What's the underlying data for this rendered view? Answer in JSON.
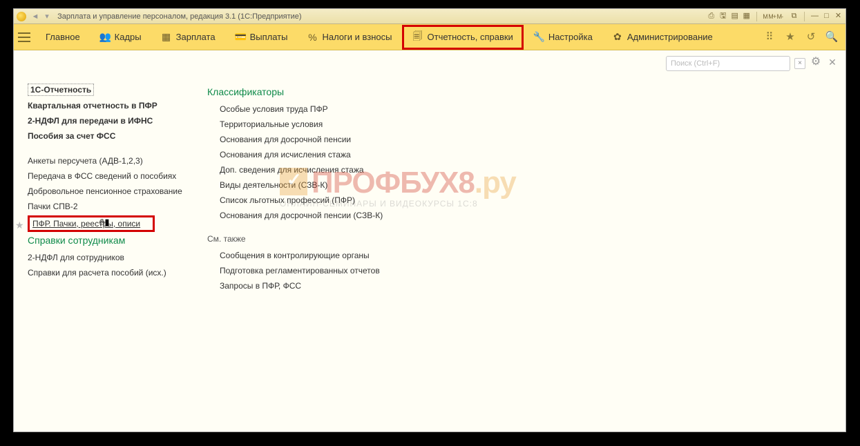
{
  "titlebar": {
    "title": "Зарплата и управление персоналом, редакция 3.1  (1С:Предприятие)",
    "mset": "M  M+  M-"
  },
  "nav": {
    "items": [
      {
        "icon": "≡",
        "name": "menu"
      },
      {
        "icon": "",
        "label": "Главное",
        "name": "main"
      },
      {
        "icon": "👥",
        "label": "Кадры",
        "name": "staff"
      },
      {
        "icon": "▦",
        "label": "Зарплата",
        "name": "salary"
      },
      {
        "icon": "💳",
        "label": "Выплаты",
        "name": "payments"
      },
      {
        "icon": "%",
        "label": "Налоги и взносы",
        "name": "taxes"
      },
      {
        "icon": "🗐",
        "label": "Отчетность, справки",
        "name": "reports",
        "active": true
      },
      {
        "icon": "🔧",
        "label": "Настройка",
        "name": "settings"
      },
      {
        "icon": "✿",
        "label": "Администрирование",
        "name": "admin"
      }
    ],
    "right": {
      "apps": "⠿",
      "star": "★",
      "history": "↺",
      "search": "🔍"
    }
  },
  "toolrow": {
    "search_placeholder": "Поиск (Ctrl+F)"
  },
  "left_col": {
    "top": [
      {
        "label": "1С-Отчетность",
        "dotted": true
      },
      {
        "label": "Квартальная отчетность в ПФР",
        "bold": true
      },
      {
        "label": "2-НДФЛ для передачи в ИФНС",
        "bold": true
      },
      {
        "label": "Пособия за счет ФСС",
        "bold": true
      }
    ],
    "mid": [
      {
        "label": "Анкеты персучета (АДВ-1,2,3)"
      },
      {
        "label": "Передача в ФСС сведений о пособиях"
      },
      {
        "label": "Добровольное пенсионное страхование"
      },
      {
        "label": "Пачки СПВ-2"
      }
    ],
    "highlighted": "ПФР. Пачки, реестры, описи",
    "section2": "Справки сотрудникам",
    "bottom": [
      {
        "label": "2-НДФЛ для сотрудников"
      },
      {
        "label": "Справки для расчета пособий (исх.)"
      }
    ]
  },
  "right_col": {
    "section": "Классификаторы",
    "items": [
      "Особые условия труда ПФР",
      "Территориальные условия",
      "Основания для досрочной пенсии",
      "Основания для исчисления стажа",
      "Доп. сведения для исчисления стажа",
      "Виды деятельности (СЗВ-К)",
      "Список льготных профессий (ПФР)",
      "Основания для досрочной пенсии (СЗВ-К)"
    ],
    "see_also_head": "См. также",
    "see_also": [
      "Сообщения в контролирующие органы",
      "Подготовка регламентированных отчетов",
      "Запросы в ПФР, ФСС"
    ]
  },
  "watermark": {
    "brand": "ПРОФБУХ8",
    "suffix": ".ру",
    "sub": "ОНЛАЙН-СЕМИНАРЫ И ВИДЕОКУРСЫ 1С:8"
  }
}
